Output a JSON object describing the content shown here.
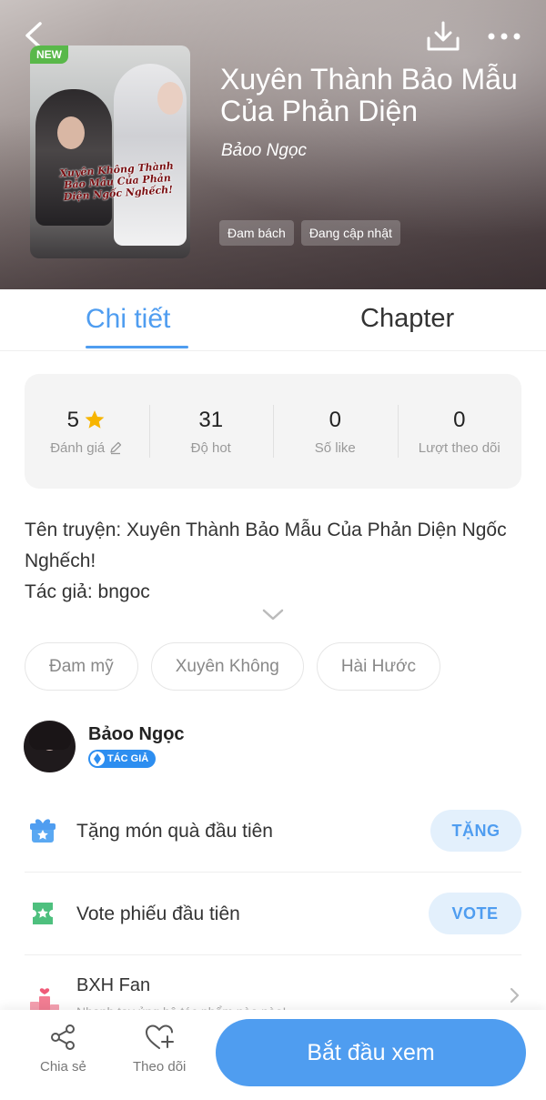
{
  "header": {
    "new_badge": "NEW",
    "title": "Xuyên Thành Bảo Mẫu Của Phản Diện",
    "author": "Bảoo Ngọc",
    "cover_text": "Xuyên Không Thành Bảo Mẫu Của Phản Diện Ngốc Nghếch!",
    "tags": [
      "Đam bách",
      "Đang cập nhật"
    ],
    "icons": [
      "back-arrow-icon",
      "download-icon",
      "more-icon"
    ]
  },
  "tabs": {
    "detail": "Chi tiết",
    "chapter": "Chapter",
    "active": "detail"
  },
  "stats": [
    {
      "value": "5",
      "label": "Đánh giá",
      "icon": "star-icon",
      "label_icon": "edit-icon"
    },
    {
      "value": "31",
      "label": "Độ hot"
    },
    {
      "value": "0",
      "label": "Số like"
    },
    {
      "value": "0",
      "label": "Lượt theo dõi"
    }
  ],
  "description": {
    "line1": "Tên truyện: Xuyên Thành Bảo Mẫu Của Phản Diện Ngốc Nghếch!",
    "line2": "Tác giả: bngoc"
  },
  "genres": [
    "Đam mỹ",
    "Xuyên Không",
    "Hài Hước"
  ],
  "author": {
    "name": "Bảoo Ngọc",
    "badge": "TÁC GIẢ"
  },
  "actions": {
    "gift_label": "Tặng món quà đầu tiên",
    "gift_button": "TẶNG",
    "vote_label": "Vote phiếu đầu tiên",
    "vote_button": "VOTE",
    "fan_label": "BXH Fan",
    "fan_sub": "Nhanh tay ủng hộ tác phẩm nào nào!"
  },
  "bottom_bar": {
    "share": "Chia sẻ",
    "follow": "Theo dõi",
    "start": "Bắt đầu xem"
  },
  "colors": {
    "accent": "#4f9df0",
    "pill_bg": "#e3f0fc",
    "new_badge": "#59b84a",
    "star": "#f7b500"
  }
}
